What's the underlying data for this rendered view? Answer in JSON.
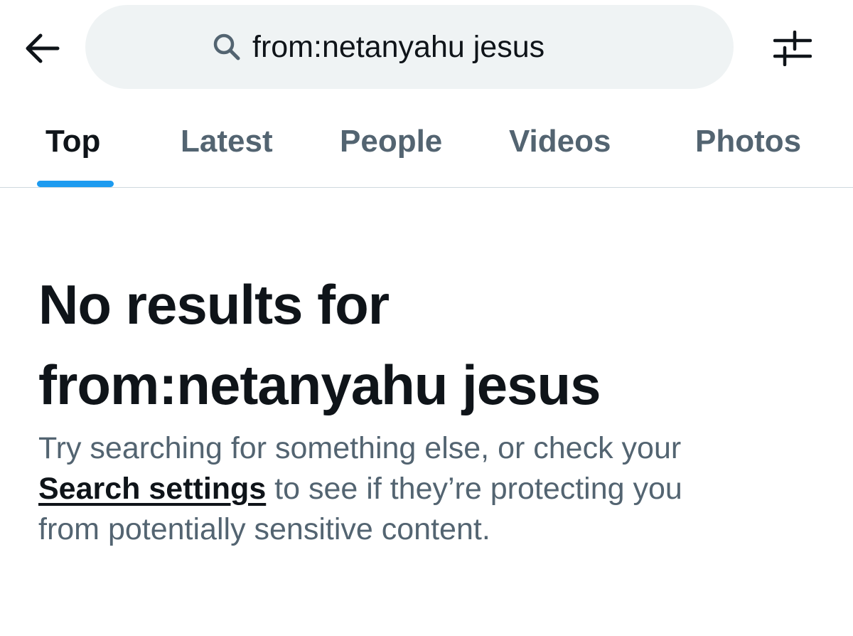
{
  "header": {
    "back_icon": "arrow-left-icon",
    "search": {
      "icon": "search-icon",
      "value": "from:netanyahu jesus"
    },
    "filter_icon": "sliders-icon"
  },
  "tabs": [
    {
      "label": "Top",
      "active": true
    },
    {
      "label": "Latest",
      "active": false
    },
    {
      "label": "People",
      "active": false
    },
    {
      "label": "Videos",
      "active": false
    },
    {
      "label": "Photos",
      "active": false
    }
  ],
  "empty_state": {
    "title_line1": "No results for",
    "title_line2": "from:netanyahu jesus",
    "body_line1": "Try searching for something else, or check your",
    "link_label": "Search settings",
    "body_line2_rest": " to see if they’re protecting you",
    "body_line3": "from potentially sensitive content."
  },
  "colors": {
    "accent": "#1d9bf0",
    "text_primary": "#0f1419",
    "text_secondary": "#536471",
    "search_bg": "#eff3f4",
    "divider": "#cfd9de"
  }
}
